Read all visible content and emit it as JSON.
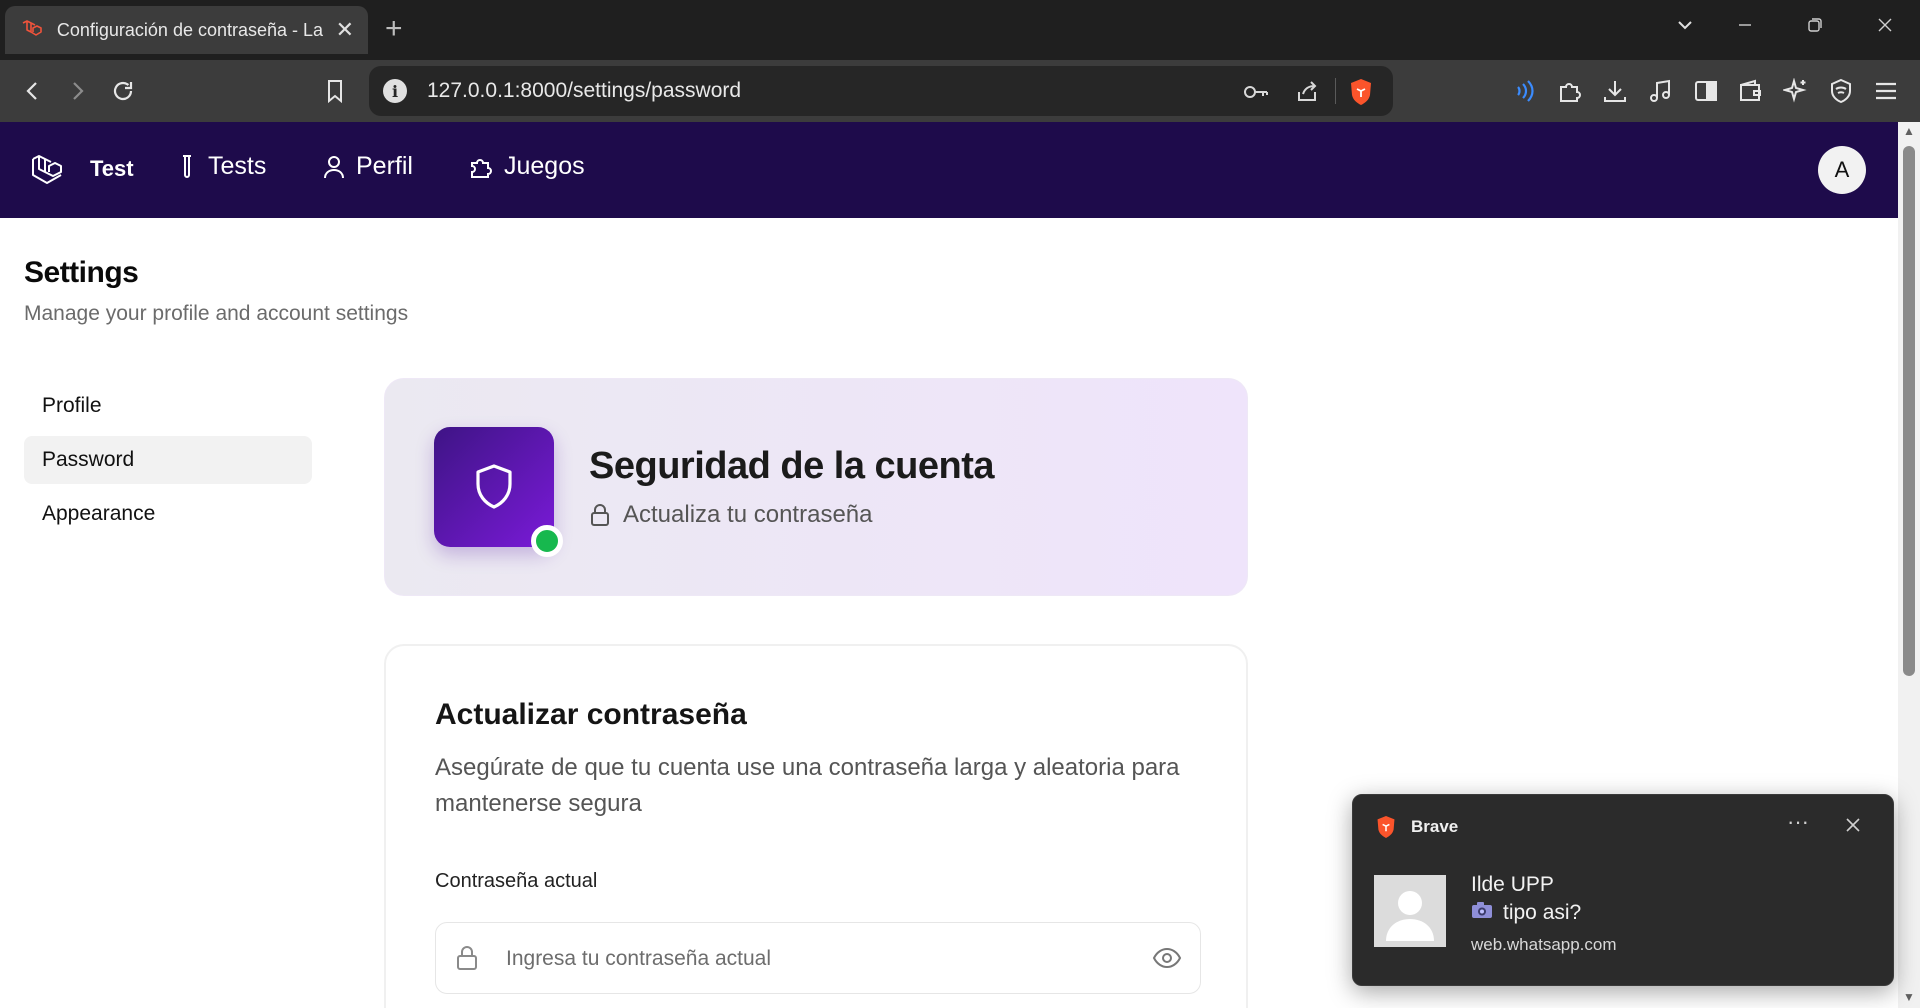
{
  "browser": {
    "tab_title": "Configuración de contraseña - La",
    "url": "127.0.0.1:8000/settings/password"
  },
  "app_nav": {
    "brand": "Test",
    "items": [
      {
        "label": "Tests",
        "icon": "test-tube-icon"
      },
      {
        "label": "Perfil",
        "icon": "user-icon"
      },
      {
        "label": "Juegos",
        "icon": "puzzle-icon"
      }
    ],
    "avatar_initial": "A"
  },
  "settings": {
    "title": "Settings",
    "subtitle": "Manage your profile and account settings",
    "nav": [
      {
        "label": "Profile",
        "active": false
      },
      {
        "label": "Password",
        "active": true
      },
      {
        "label": "Appearance",
        "active": false
      }
    ]
  },
  "hero": {
    "title": "Seguridad de la cuenta",
    "subtitle": "Actualiza tu contraseña",
    "status_color": "#17b84e"
  },
  "card": {
    "title": "Actualizar contraseña",
    "description": "Asegúrate de que tu cuenta use una contraseña larga y aleatoria para mantenerse segura",
    "current_password_label": "Contraseña actual",
    "current_password_placeholder": "Ingresa tu contraseña actual",
    "current_password_value": ""
  },
  "notification": {
    "app": "Brave",
    "sender": "Ilde UPP",
    "message": "tipo asi?",
    "source": "web.whatsapp.com"
  },
  "colors": {
    "nav_bg": "#1e0b4b",
    "accent": "#7a1ad8",
    "brave": "#fb542b"
  }
}
